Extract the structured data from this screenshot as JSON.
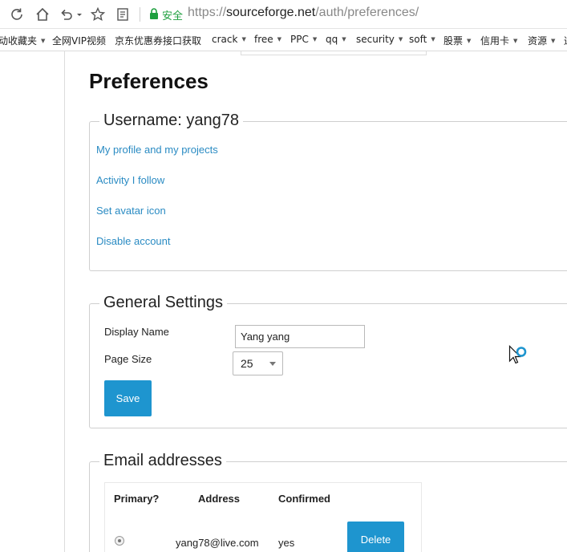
{
  "browser": {
    "secure_label": "安全",
    "url_scheme": "https://",
    "url_domain": "sourceforge.net",
    "url_path": "/auth/preferences/"
  },
  "bookmarks": [
    {
      "label": "动收藏夹",
      "dropdown": true
    },
    {
      "label": "全网VIP视频",
      "dropdown": false
    },
    {
      "label": "京东优惠券接口获取",
      "dropdown": false
    },
    {
      "label": "crack",
      "dropdown": true
    },
    {
      "label": "free",
      "dropdown": true
    },
    {
      "label": "PPC",
      "dropdown": true
    },
    {
      "label": "qq",
      "dropdown": true
    },
    {
      "label": "security",
      "dropdown": true
    },
    {
      "label": "soft",
      "dropdown": true
    },
    {
      "label": "股票",
      "dropdown": true
    },
    {
      "label": "信用卡",
      "dropdown": true
    },
    {
      "label": "资源",
      "dropdown": true
    },
    {
      "label": "通",
      "dropdown": false
    }
  ],
  "page": {
    "title": "Preferences",
    "username_section": {
      "legend": "Username: yang78",
      "links": [
        "My profile and my projects",
        "Activity I follow",
        "Set avatar icon",
        "Disable account"
      ]
    },
    "general_section": {
      "legend": "General Settings",
      "display_name_label": "Display Name",
      "display_name_value": "Yang yang",
      "page_size_label": "Page Size",
      "page_size_value": "25",
      "save_label": "Save"
    },
    "email_section": {
      "legend": "Email addresses",
      "columns": [
        "Primary?",
        "Address",
        "Confirmed"
      ],
      "rows": [
        {
          "primary": true,
          "address": "yang78@live.com",
          "confirmed": "yes",
          "delete_label": "Delete"
        }
      ]
    }
  },
  "colors": {
    "link": "#2a8bc3",
    "button": "#1e95cf",
    "secure": "#1d9f3e"
  }
}
